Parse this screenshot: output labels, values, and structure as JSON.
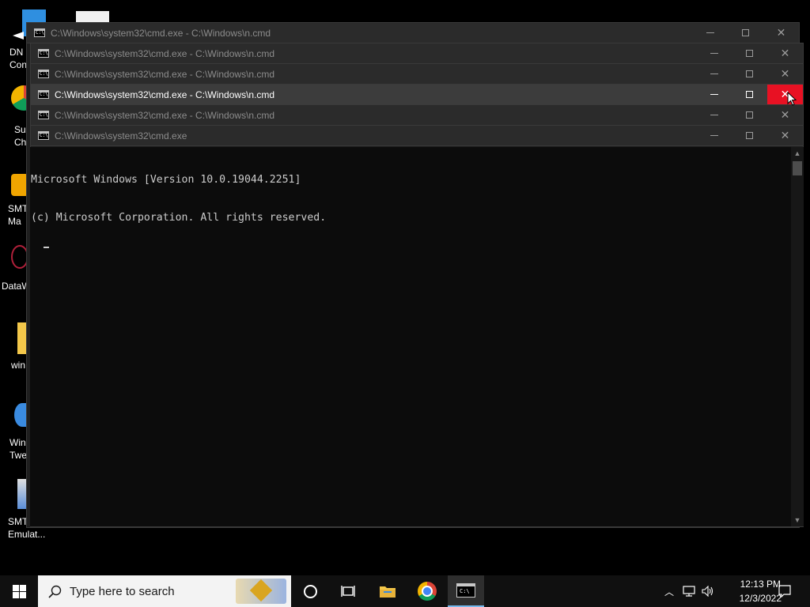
{
  "desktop": {
    "icons": [
      {
        "label": "DN\nCon"
      },
      {
        "label": "Su\nCh"
      },
      {
        "label": "SMT\nMa"
      },
      {
        "label": "DataW"
      },
      {
        "label": "win"
      },
      {
        "label": "Win\nTwe"
      },
      {
        "label": "SMT\nEmulat..."
      }
    ]
  },
  "windows": [
    {
      "title": "C:\\Windows\\system32\\cmd.exe - C:\\Windows\\n.cmd",
      "active": false
    },
    {
      "title": "C:\\Windows\\system32\\cmd.exe - C:\\Windows\\n.cmd",
      "active": false
    },
    {
      "title": "C:\\Windows\\system32\\cmd.exe - C:\\Windows\\n.cmd",
      "active": false
    },
    {
      "title": "C:\\Windows\\system32\\cmd.exe - C:\\Windows\\n.cmd",
      "active": true
    },
    {
      "title": "C:\\Windows\\system32\\cmd.exe - C:\\Windows\\n.cmd",
      "active": false
    },
    {
      "title": "C:\\Windows\\system32\\cmd.exe",
      "active": false
    }
  ],
  "console": {
    "line1": "Microsoft Windows [Version 10.0.19044.2251]",
    "line2": "(c) Microsoft Corporation. All rights reserved."
  },
  "taskbar": {
    "search_placeholder": "Type here to search",
    "time": "12:13 PM",
    "date": "12/3/2022"
  },
  "colors": {
    "close_hover": "#e81123",
    "taskbar": "#101010",
    "console_bg": "#0c0c0c"
  }
}
